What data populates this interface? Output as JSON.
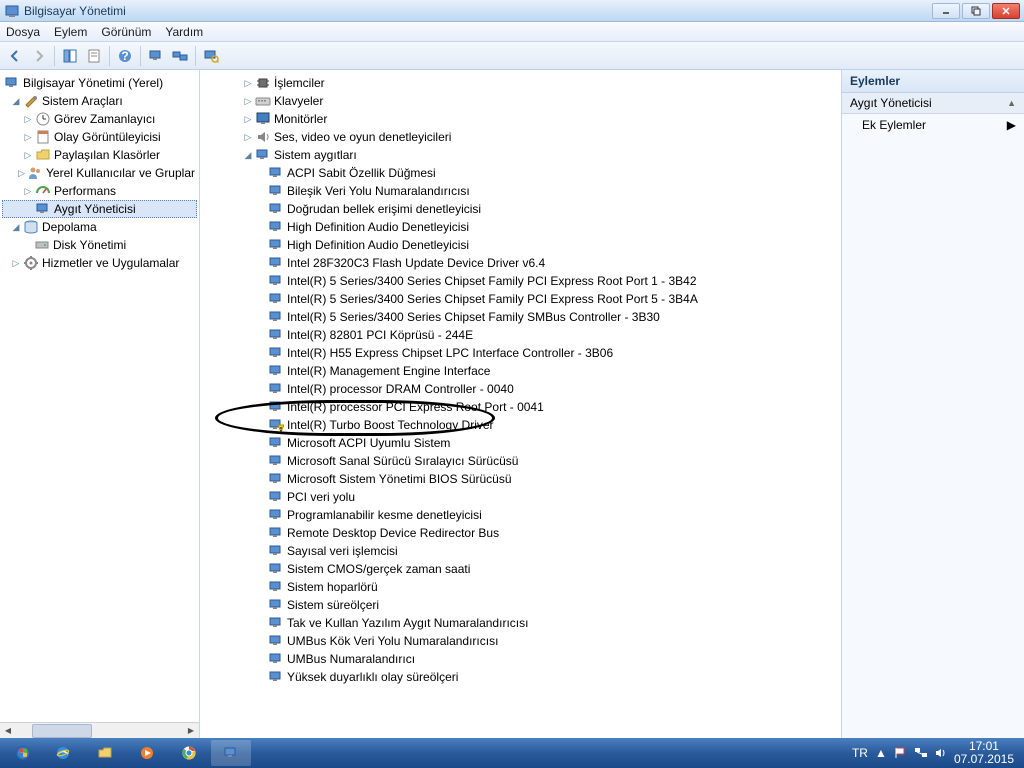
{
  "window": {
    "title": "Bilgisayar Yönetimi"
  },
  "menu": {
    "file": "Dosya",
    "action": "Eylem",
    "view": "Görünüm",
    "help": "Yardım"
  },
  "left_tree": {
    "root": "Bilgisayar Yönetimi (Yerel)",
    "system_tools": "Sistem Araçları",
    "task_scheduler": "Görev Zamanlayıcı",
    "event_viewer": "Olay Görüntüleyicisi",
    "shared_folders": "Paylaşılan Klasörler",
    "local_users": "Yerel Kullanıcılar ve Gruplar",
    "performance": "Performans",
    "device_manager": "Aygıt Yöneticisi",
    "storage": "Depolama",
    "disk_mgmt": "Disk Yönetimi",
    "services": "Hizmetler ve Uygulamalar"
  },
  "center_tree": {
    "processors": "İşlemciler",
    "keyboards": "Klavyeler",
    "monitors": "Monitörler",
    "sound": "Ses, video ve oyun denetleyicileri",
    "system_devices": "Sistem aygıtları",
    "items": [
      "ACPI Sabit Özellik Düğmesi",
      "Bileşik Veri Yolu Numaralandırıcısı",
      "Doğrudan bellek erişimi denetleyicisi",
      "High Definition Audio Denetleyicisi",
      "High Definition Audio Denetleyicisi",
      "Intel 28F320C3 Flash Update Device Driver v6.4",
      "Intel(R) 5 Series/3400 Series Chipset Family PCI Express Root Port 1 - 3B42",
      "Intel(R) 5 Series/3400 Series Chipset Family PCI Express Root Port 5 - 3B4A",
      "Intel(R) 5 Series/3400 Series Chipset Family SMBus Controller - 3B30",
      "Intel(R) 82801 PCI Köprüsü - 244E",
      "Intel(R) H55 Express Chipset LPC Interface Controller - 3B06",
      "Intel(R) Management Engine Interface",
      "Intel(R) processor DRAM Controller - 0040",
      "Intel(R) processor PCI Express Root Port - 0041",
      "Intel(R) Turbo Boost Technology Driver",
      "Microsoft ACPI Uyumlu Sistem",
      "Microsoft Sanal Sürücü Sıralayıcı Sürücüsü",
      "Microsoft Sistem Yönetimi BIOS Sürücüsü",
      "PCI veri yolu",
      "Programlanabilir kesme denetleyicisi",
      "Remote Desktop Device Redirector Bus",
      "Sayısal veri işlemcisi",
      "Sistem CMOS/gerçek zaman saati",
      "Sistem hoparlörü",
      "Sistem süreölçeri",
      "Tak ve Kullan Yazılım Aygıt Numaralandırıcısı",
      "UMBus Kök Veri Yolu Numaralandırıcısı",
      "UMBus Numaralandırıcı",
      "Yüksek duyarlıklı olay süreölçeri"
    ]
  },
  "actions_panel": {
    "header": "Eylemler",
    "sub": "Aygıt Yöneticisi",
    "more": "Ek Eylemler"
  },
  "tray": {
    "lang": "TR",
    "time": "17:01",
    "date": "07.07.2015"
  }
}
